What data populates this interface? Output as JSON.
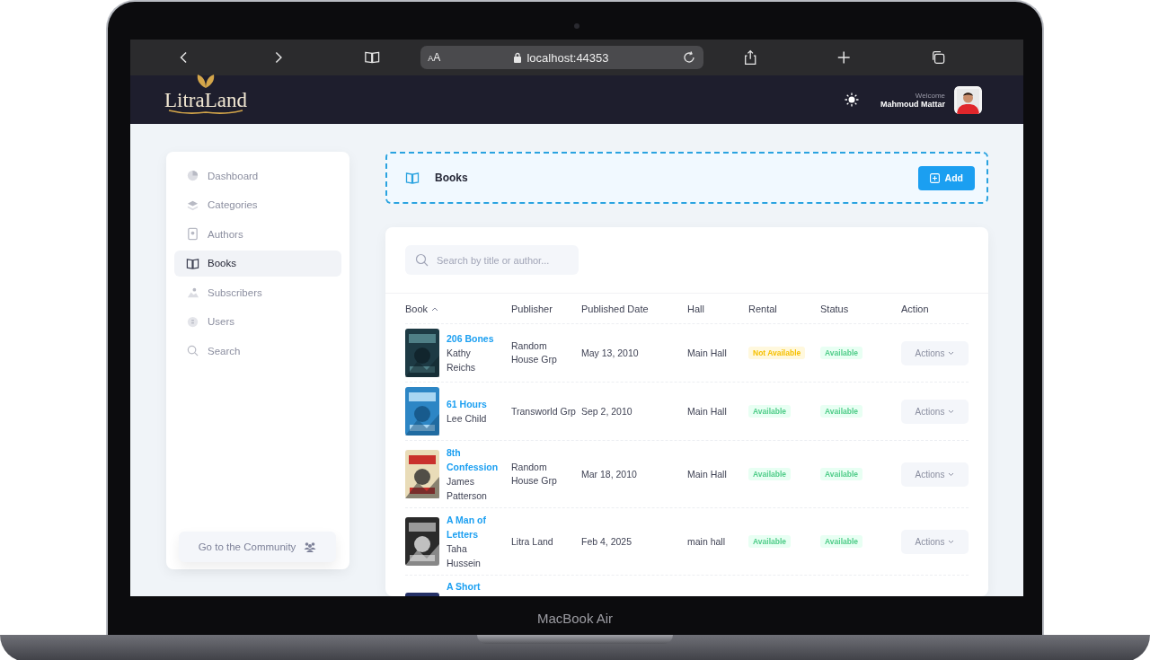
{
  "browser": {
    "text_size_button": "AA",
    "url": "localhost:44353"
  },
  "header": {
    "logo": "LitraLand",
    "welcome": "Welcome",
    "user_name": "Mahmoud Mattar"
  },
  "sidebar": {
    "items": [
      {
        "label": "Dashboard",
        "selected": false
      },
      {
        "label": "Categories",
        "selected": false
      },
      {
        "label": "Authors",
        "selected": false
      },
      {
        "label": "Books",
        "selected": true
      },
      {
        "label": "Subscribers",
        "selected": false
      },
      {
        "label": "Users",
        "selected": false
      },
      {
        "label": "Search",
        "selected": false
      }
    ],
    "community_button": "Go to the Community"
  },
  "page_header": {
    "title": "Books",
    "add_button": "Add"
  },
  "search": {
    "placeholder": "Search by title or author..."
  },
  "table": {
    "columns": [
      {
        "label": "Book",
        "sorted": true
      },
      {
        "label": "Publisher",
        "sorted": false
      },
      {
        "label": "Published Date",
        "sorted": false
      },
      {
        "label": "Hall",
        "sorted": false
      },
      {
        "label": "Rental",
        "sorted": false
      },
      {
        "label": "Status",
        "sorted": false
      },
      {
        "label": "Action",
        "sorted": false
      }
    ],
    "rows": [
      {
        "title": "206 Bones",
        "author": "Kathy Reichs",
        "publisher": "Random House Grp",
        "published_date": "May 13, 2010",
        "hall": "Main Hall",
        "rental": {
          "label": "Not Available",
          "kind": "warning"
        },
        "status": {
          "label": "Available",
          "kind": "success"
        },
        "action": "Actions"
      },
      {
        "title": "61 Hours",
        "author": "Lee Child",
        "publisher": "Transworld Grp",
        "published_date": "Sep 2, 2010",
        "hall": "Main Hall",
        "rental": {
          "label": "Available",
          "kind": "success"
        },
        "status": {
          "label": "Available",
          "kind": "success"
        },
        "action": "Actions"
      },
      {
        "title": "8th Confession",
        "author": "James Patterson",
        "publisher": "Random House Grp",
        "published_date": "Mar 18, 2010",
        "hall": "Main Hall",
        "rental": {
          "label": "Available",
          "kind": "success"
        },
        "status": {
          "label": "Available",
          "kind": "success"
        },
        "action": "Actions"
      },
      {
        "title": "A Man of Letters",
        "author": "Taha Hussein",
        "publisher": "Litra Land",
        "published_date": "Feb 4, 2025",
        "hall": "main hall",
        "rental": {
          "label": "Available",
          "kind": "success"
        },
        "status": {
          "label": "Available",
          "kind": "success"
        },
        "action": "Actions"
      },
      {
        "title": "A Short"
      }
    ]
  },
  "device": {
    "label": "MacBook Air"
  }
}
